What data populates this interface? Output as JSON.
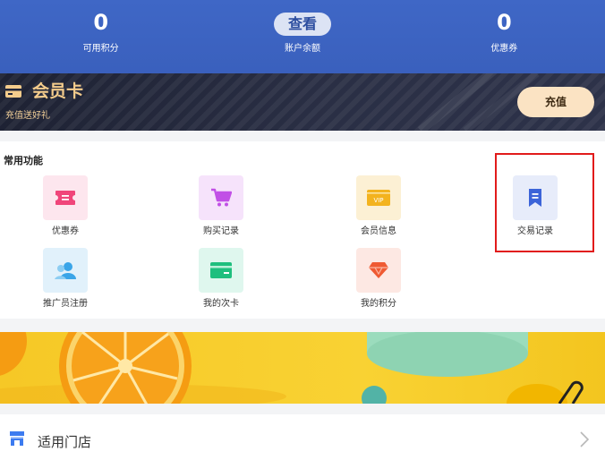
{
  "stats": {
    "points_value": "0",
    "points_label": "可用积分",
    "balance_button": "查看",
    "balance_label": "账户余额",
    "coupons_value": "0",
    "coupons_label": "优惠券"
  },
  "member_card": {
    "title": "会员卡",
    "subtitle": "充值送好礼",
    "recharge_label": "充值"
  },
  "functions": {
    "title": "常用功能",
    "items": [
      {
        "label": "优惠券",
        "icon": "ticket-icon",
        "color": "#f0457a"
      },
      {
        "label": "购买记录",
        "icon": "cart-icon",
        "color": "#c150e6"
      },
      {
        "label": "会员信息",
        "icon": "vip-card-icon",
        "color": "#f3b31f"
      },
      {
        "label": "交易记录",
        "icon": "bookmark-icon",
        "color": "#3c64d8"
      },
      {
        "label": "推广员注册",
        "icon": "users-icon",
        "color": "#3aa5e8"
      },
      {
        "label": "我的次卡",
        "icon": "card-icon",
        "color": "#1fbf7e"
      },
      {
        "label": "我的积分",
        "icon": "gem-icon",
        "color": "#ef5a33"
      }
    ]
  },
  "store": {
    "label": "适用门店"
  },
  "colors": {
    "header_blue": "#3f67c6",
    "card_dark": "#22263a",
    "gold": "#f4cc8c",
    "highlight_red": "#e11b1b",
    "banner_yellow": "#f6c826"
  }
}
